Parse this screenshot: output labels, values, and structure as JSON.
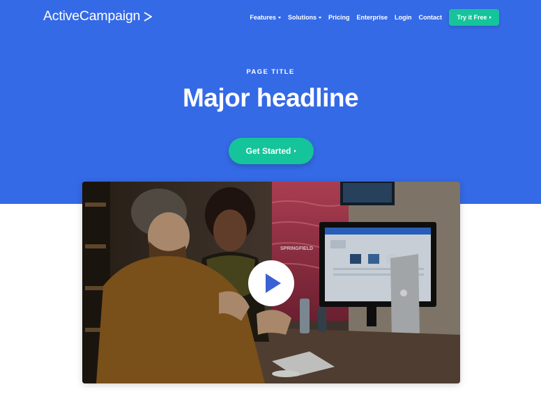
{
  "header": {
    "logo_text": "ActiveCampaign",
    "nav": [
      {
        "label": "Features",
        "has_dropdown": true
      },
      {
        "label": "Solutions",
        "has_dropdown": true
      },
      {
        "label": "Pricing",
        "has_dropdown": false
      },
      {
        "label": "Enterprise",
        "has_dropdown": false
      },
      {
        "label": "Login",
        "has_dropdown": false
      },
      {
        "label": "Contact",
        "has_dropdown": false
      }
    ],
    "cta_label": "Try it Free"
  },
  "hero": {
    "eyebrow": "PAGE TITLE",
    "headline": "Major headline",
    "cta_label": "Get Started"
  },
  "video": {
    "sign_text": "SPRINGFIELD"
  },
  "colors": {
    "hero_bg": "#356ae6",
    "accent": "#15c49a",
    "play_icon": "#3a62d6"
  }
}
